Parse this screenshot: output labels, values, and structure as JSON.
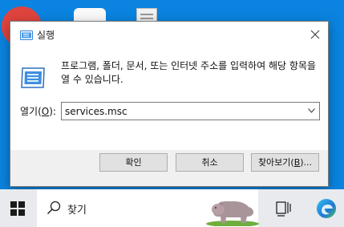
{
  "dialog": {
    "title": "실행",
    "description": "프로그램, 폴더, 문서, 또는 인터넷 주소를 입력하여 해당 항목을 열 수 있습니다.",
    "open_label_pre": "열기(",
    "open_label_key": "O",
    "open_label_post": "):",
    "input_value": "services.msc",
    "ok_label": "확인",
    "cancel_label": "취소",
    "browse_label_pre": "찾아보기(",
    "browse_label_key": "B",
    "browse_label_post": ")..."
  },
  "taskbar": {
    "search_text": "찾기"
  },
  "icons": {
    "title": "run-icon",
    "close": "close-icon",
    "dropdown": "chevron-down-icon",
    "start": "windows-logo-icon",
    "search": "search-icon",
    "highlight": "search-highlight-hippo-icon",
    "taskview": "task-view-icon",
    "edge": "edge-icon"
  },
  "colors": {
    "accent": "#0078d7",
    "dialog_bg": "#f0f0f0",
    "button_bg": "#e1e1e1",
    "taskbar_bg": "#e8eaee"
  }
}
